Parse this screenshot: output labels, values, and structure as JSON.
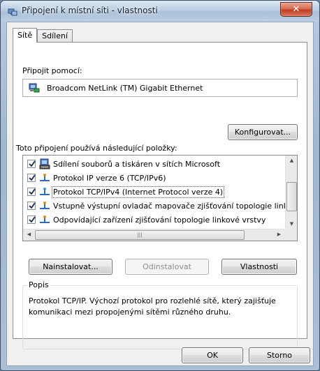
{
  "window": {
    "title": "Připojení k místní síti - vlastnosti",
    "close_symbol": "✕"
  },
  "tabs": [
    {
      "label": "Sítě",
      "active": true
    },
    {
      "label": "Sdílení",
      "active": false
    }
  ],
  "connect_using": {
    "label": "Připojit pomocí:",
    "adapter": "Broadcom NetLink (TM) Gigabit Ethernet",
    "adapter_icon": "network-adapter-icon",
    "configure_button": "Konfigurovat..."
  },
  "items": {
    "label": "Toto připojení používá následující položky:",
    "list": [
      {
        "text": "Sdílení souborů a tiskáren v sítích Microsoft",
        "checked": true,
        "icon": "file-printer-sharing-icon"
      },
      {
        "text": "Protokol IP verze 6 (TCP/IPv6)",
        "checked": true,
        "icon": "protocol-icon"
      },
      {
        "text": "Protokol TCP/IPv4 (Internet Protocol verze 4)",
        "checked": true,
        "icon": "protocol-icon",
        "selected": true
      },
      {
        "text": "Vstupně výstupní ovladač mapovače zjišťování topologie linkové vrstvy",
        "checked": true,
        "icon": "protocol-icon"
      },
      {
        "text": "Odpovídající zařízení zjišťování topologie linkové vrstvy",
        "checked": true,
        "icon": "protocol-icon"
      }
    ]
  },
  "buttons": {
    "install": "Nainstalovat...",
    "uninstall": "Odinstalovat",
    "properties": "Vlastnosti",
    "ok": "OK",
    "cancel": "Storno"
  },
  "description": {
    "title": "Popis",
    "text": "Protokol TCP/IP. Výchozí protokol pro rozlehlé sítě, který zajišťuje komunikaci mezi propojenými sítěmi různého druhu."
  }
}
